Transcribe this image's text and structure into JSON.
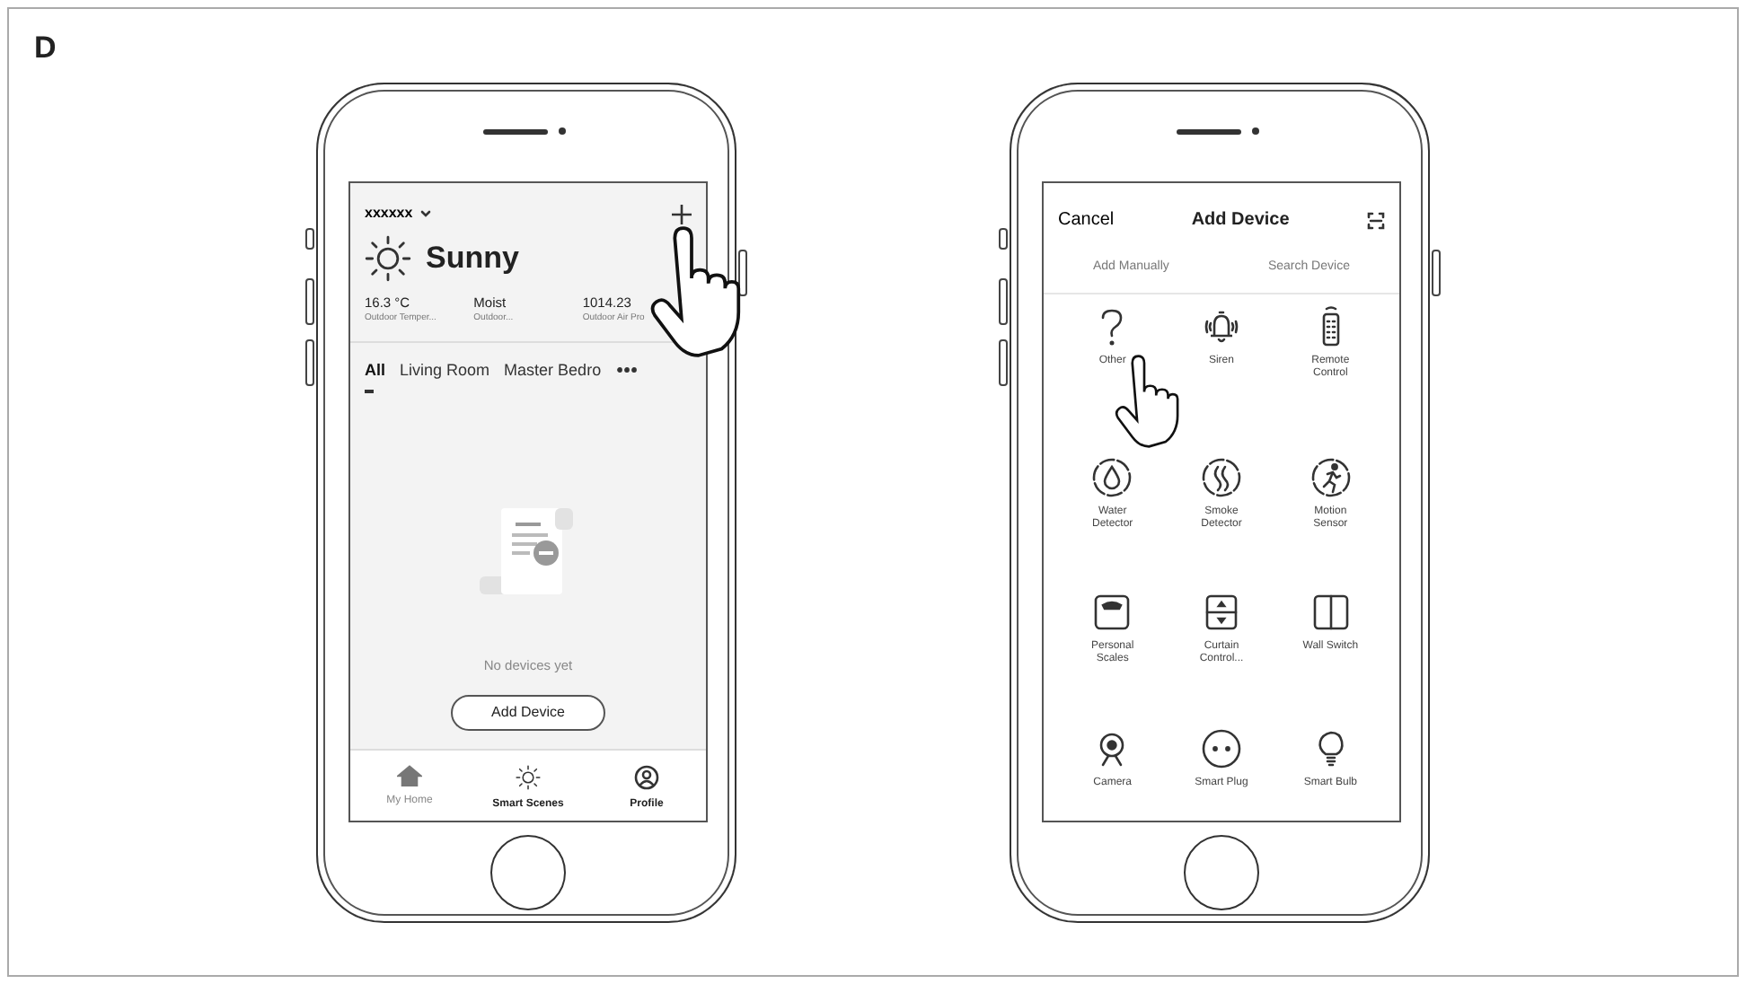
{
  "page_label": "D",
  "home_screen": {
    "home_name": "xxxxxx",
    "weather": "Sunny",
    "stats": [
      {
        "value": "16.3 °C",
        "label": "Outdoor Temper..."
      },
      {
        "value": "Moist",
        "label": "Outdoor..."
      },
      {
        "value": "1014.23",
        "label": "Outdoor Air Pro"
      }
    ],
    "rooms": [
      {
        "label": "All",
        "selected": true
      },
      {
        "label": "Living Room",
        "selected": false
      },
      {
        "label": "Master Bedro",
        "selected": false
      }
    ],
    "empty_message": "No devices yet",
    "add_button": "Add Device",
    "nav": [
      {
        "label": "My Home",
        "selected": true
      },
      {
        "label": "Smart Scenes",
        "selected": false
      },
      {
        "label": "Profile",
        "selected": false
      }
    ]
  },
  "add_device_screen": {
    "cancel": "Cancel",
    "title": "Add Device",
    "modes": [
      "Add Manually",
      "Search Device"
    ],
    "devices": [
      "Other",
      "Siren",
      "Remote Control",
      "Water Detector",
      "Smoke Detector",
      "Motion Sensor",
      "Personal Scales",
      "Curtain Control...",
      "Wall Switch",
      "Camera",
      "Smart Plug",
      "Smart Bulb"
    ]
  }
}
